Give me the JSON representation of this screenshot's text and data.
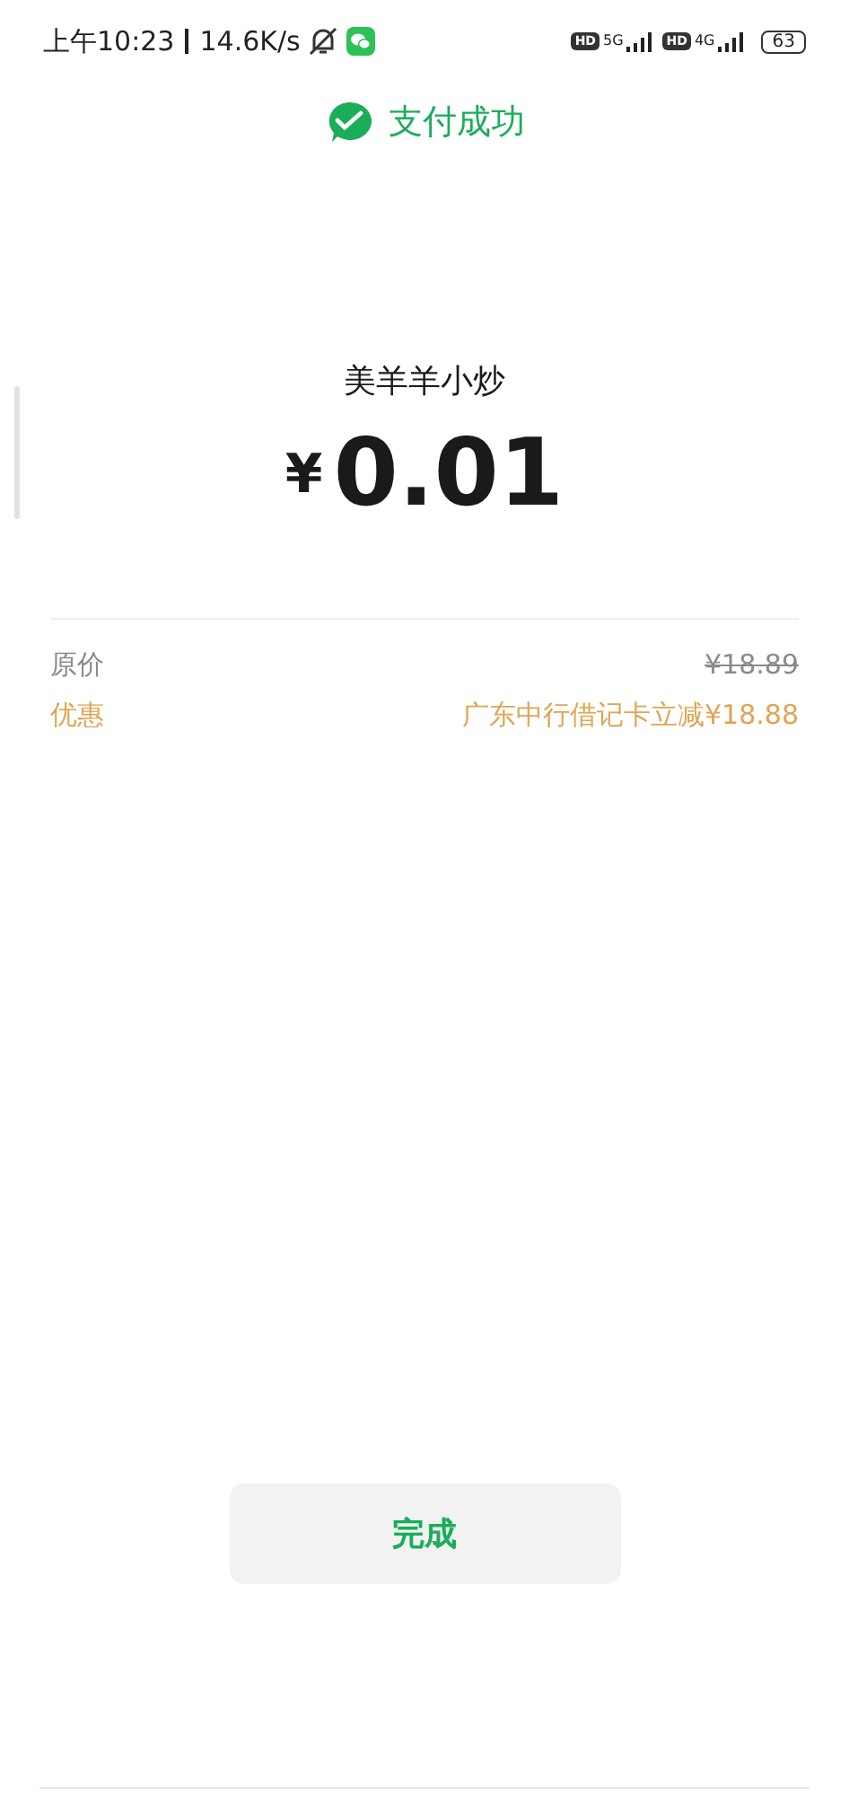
{
  "status_bar": {
    "time": "上午10:23",
    "speed": "14.6K/s",
    "sim": [
      {
        "badge": "HD",
        "network": "5G"
      },
      {
        "badge": "HD",
        "network": "4G"
      }
    ],
    "battery": "63"
  },
  "header": {
    "title": "支付成功"
  },
  "payment": {
    "merchant": "美羊羊小炒",
    "currency": "¥",
    "amount": "0.01"
  },
  "details": [
    {
      "kind": "original",
      "label": "原价",
      "value": "¥18.89"
    },
    {
      "kind": "discount",
      "label": "优惠",
      "value": "广东中行借记卡立减¥18.88"
    }
  ],
  "done_button": "完成"
}
